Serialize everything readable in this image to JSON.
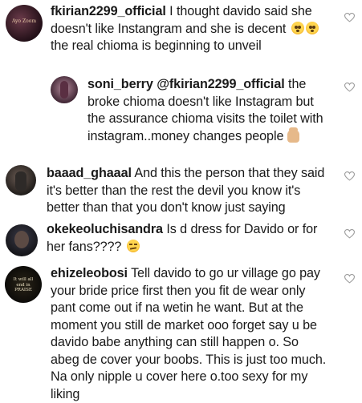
{
  "comments": [
    {
      "username": "fkirian2299_official",
      "text": "I thought davido said she doesn't like Instangram and she is decent",
      "emoji": "flushed-face-emoji x2",
      "text_after": "the real chioma is beginning to unveil",
      "avatar_text": "Ayo Zoom"
    },
    {
      "username": "soni_berry",
      "mention": "@fkirian2299_official",
      "text": "the broke chioma doesn't like Instagram but the assurance chioma visits the toilet with instagram..money changes people",
      "emoji": "raised-hand-emoji"
    },
    {
      "username": "baaad_ghaaal",
      "text": "And this the person that they said it's better than the rest the devil you know it's better than that you don't know just saying"
    },
    {
      "username": "okekeoluchisandra",
      "text": "Is d dress for Davido or for her fans????",
      "emoji": "smirking-face-emoji"
    },
    {
      "username": "ehizeleobosi",
      "text": "Tell davido to go ur village go pay your bride price first then you fit de wear only pant come out if na wetin he want. But at the moment you still de market ooo forget say u be davido babe anything can still happen o. So abeg de cover your boobs. This is just too much. Na only nipple u cover here o.too sexy for my liking",
      "avatar_text": "It will all end in PRAISE"
    }
  ],
  "colors": {
    "text": "#1a1a1a",
    "heart": "#9a9a9a"
  }
}
